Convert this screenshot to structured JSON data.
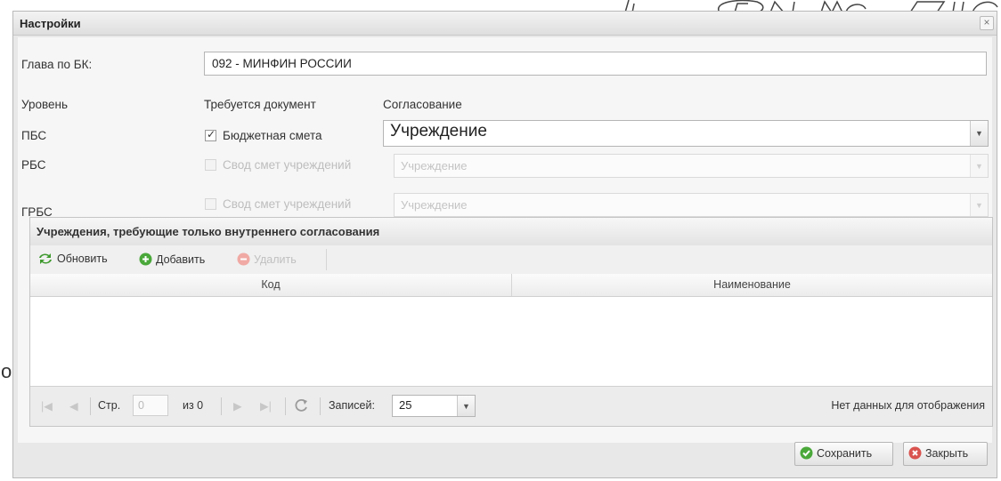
{
  "window": {
    "title": "Настройки"
  },
  "form": {
    "chapter_label": "Глава по БК:",
    "chapter_value": "092 - МИНФИН РОССИИ",
    "col_level": "Уровень",
    "col_doc": "Требуется документ",
    "col_approval": "Согласование",
    "rows": [
      {
        "level": "ПБС",
        "doc_label": "Бюджетная смета",
        "checked": true,
        "enabled": true,
        "approval": "Учреждение"
      },
      {
        "level": "РБС",
        "doc_label": "Свод смет учреждений",
        "checked": false,
        "enabled": false,
        "approval": "Учреждение"
      },
      {
        "level": "ГРБС",
        "doc_label": "Свод смет учреждений",
        "checked": false,
        "enabled": false,
        "approval": "Учреждение"
      }
    ]
  },
  "grid": {
    "title": "Учреждения, требующие только внутреннего согласования",
    "toolbar": {
      "refresh": "Обновить",
      "add": "Добавить",
      "delete": "Удалить"
    },
    "columns": [
      "Код",
      "Наименование"
    ],
    "pager": {
      "page_label": "Стр.",
      "page_value": "0",
      "of_label": "из 0",
      "records_label": "Записей:",
      "records_value": "25",
      "empty_text": "Нет данных для отображения"
    }
  },
  "footer": {
    "save": "Сохранить",
    "close": "Закрыть"
  },
  "background": {
    "letter": "o"
  },
  "colors": {
    "green": "#4aa83a",
    "red": "#d9534f",
    "border": "#b5b5b5"
  }
}
